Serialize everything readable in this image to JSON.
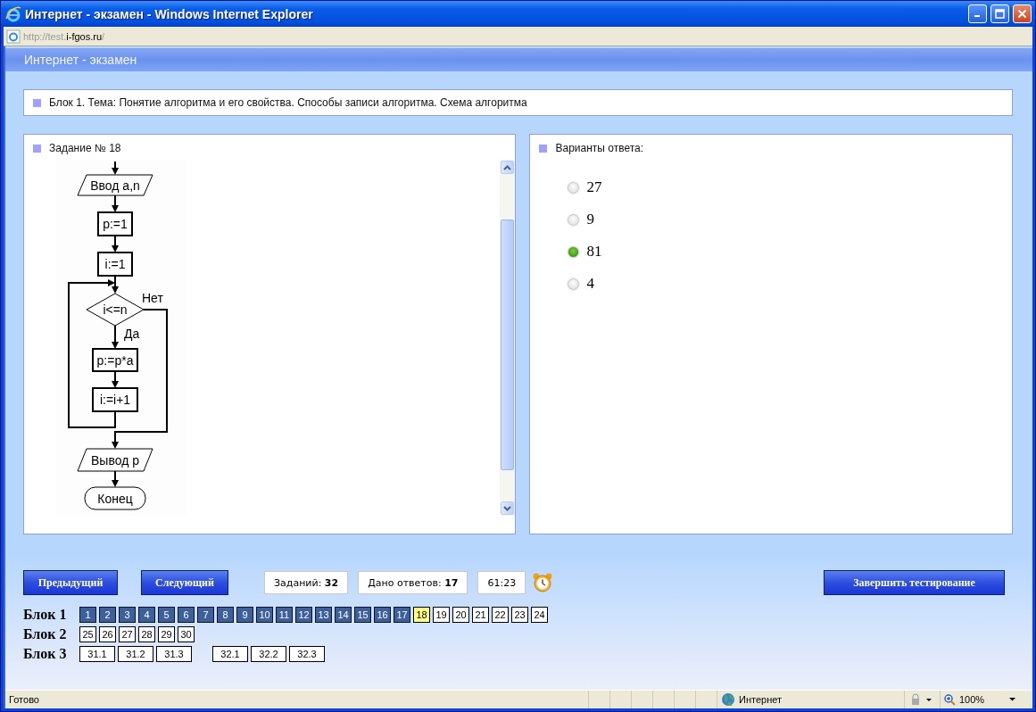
{
  "window": {
    "title": "Интернет - экзамен - Windows Internet Explorer"
  },
  "address": {
    "scheme_part": "http://test.",
    "domain": "i-fgos.ru",
    "path": "/"
  },
  "page_header": "Интернет - экзамен",
  "topic": "Блок 1. Тема: Понятие алгоритма и его свойства. Способы записи алгоритма. Схема алгоритма",
  "task": {
    "title": "Задание № 18",
    "flowchart": [
      {
        "kind": "io",
        "text": "Ввод a,n"
      },
      {
        "kind": "process",
        "text": "p:=1"
      },
      {
        "kind": "process",
        "text": "i:=1"
      },
      {
        "kind": "decision",
        "text": "i<=n",
        "no_label": "Нет",
        "yes_label": "Да"
      },
      {
        "kind": "process",
        "text": "p:=p*a"
      },
      {
        "kind": "process",
        "text": "i:=i+1"
      },
      {
        "kind": "io",
        "text": "Вывод p"
      },
      {
        "kind": "terminal",
        "text": "Конец"
      }
    ]
  },
  "answers": {
    "title": "Варианты ответа:",
    "options": [
      {
        "label": "27",
        "selected": false
      },
      {
        "label": "9",
        "selected": false
      },
      {
        "label": "81",
        "selected": true
      },
      {
        "label": "4",
        "selected": false
      }
    ]
  },
  "nav_buttons": [
    "Предыдущий",
    "Следующий"
  ],
  "counters": [
    "Заданий: **32**",
    "Дано ответов: **17**",
    "61:23"
  ],
  "finish_button": "Завершить тестирование",
  "blocks": [
    {
      "label": "Блок 1",
      "groups": [
        [
          {
            "n": "1",
            "answered": true,
            "selected": false
          },
          {
            "n": "2",
            "answered": true,
            "selected": false
          },
          {
            "n": "3",
            "answered": true,
            "selected": false
          },
          {
            "n": "4",
            "answered": true,
            "selected": false
          },
          {
            "n": "5",
            "answered": true,
            "selected": false
          },
          {
            "n": "6",
            "answered": true,
            "selected": false
          },
          {
            "n": "7",
            "answered": true,
            "selected": false
          },
          {
            "n": "8",
            "answered": true,
            "selected": false
          },
          {
            "n": "9",
            "answered": true,
            "selected": false
          },
          {
            "n": "10",
            "answered": true,
            "selected": false
          },
          {
            "n": "11",
            "answered": true,
            "selected": false
          },
          {
            "n": "12",
            "answered": true,
            "selected": false
          },
          {
            "n": "13",
            "answered": true,
            "selected": false
          },
          {
            "n": "14",
            "answered": true,
            "selected": false
          },
          {
            "n": "15",
            "answered": true,
            "selected": false
          },
          {
            "n": "16",
            "answered": true,
            "selected": false
          },
          {
            "n": "17",
            "answered": true,
            "selected": false
          },
          {
            "n": "18",
            "answered": false,
            "selected": true
          },
          {
            "n": "19",
            "answered": false,
            "selected": false
          },
          {
            "n": "20",
            "answered": false,
            "selected": false
          },
          {
            "n": "21",
            "answered": false,
            "selected": false
          },
          {
            "n": "22",
            "answered": false,
            "selected": false
          },
          {
            "n": "23",
            "answered": false,
            "selected": false
          },
          {
            "n": "24",
            "answered": false,
            "selected": false
          }
        ]
      ]
    },
    {
      "label": "Блок 2",
      "groups": [
        [
          {
            "n": "25",
            "answered": false,
            "selected": false
          },
          {
            "n": "26",
            "answered": false,
            "selected": false
          },
          {
            "n": "27",
            "answered": false,
            "selected": false
          },
          {
            "n": "28",
            "answered": false,
            "selected": false
          },
          {
            "n": "29",
            "answered": false,
            "selected": false
          },
          {
            "n": "30",
            "answered": false,
            "selected": false
          }
        ]
      ]
    },
    {
      "label": "Блок 3",
      "groups": [
        [
          {
            "n": "31.1",
            "answered": false,
            "selected": false
          },
          {
            "n": "31.2",
            "answered": false,
            "selected": false
          },
          {
            "n": "31.3",
            "answered": false,
            "selected": false
          }
        ],
        [
          {
            "n": "32.1",
            "answered": false,
            "selected": false
          },
          {
            "n": "32.2",
            "answered": false,
            "selected": false
          },
          {
            "n": "32.3",
            "answered": false,
            "selected": false
          }
        ]
      ]
    }
  ],
  "status_bar": {
    "text": "Готово",
    "zone": "Интернет",
    "zoom": "100%"
  }
}
